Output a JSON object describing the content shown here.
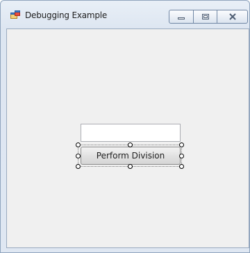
{
  "window": {
    "title": "Debugging Example",
    "app_icon": "form-icon",
    "caption_icons": [
      "minimize-icon",
      "maximize-icon",
      "close-icon"
    ]
  },
  "form": {
    "input_value": "",
    "button_label": "Perform Division",
    "selected_control": "Perform Division"
  },
  "colors": {
    "client_background": "#f0f0f0",
    "frame": "#dde6f1"
  }
}
